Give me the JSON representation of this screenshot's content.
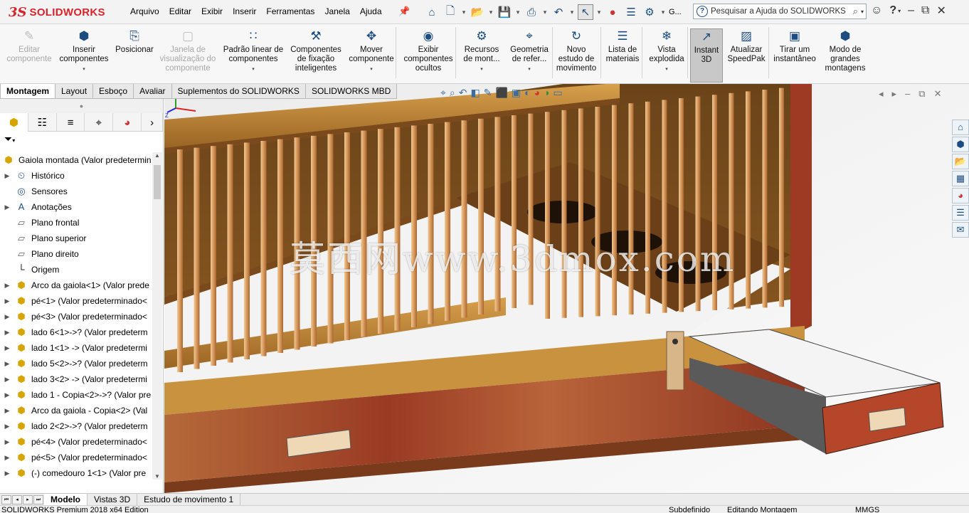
{
  "app": {
    "brand": "SOLIDWORKS",
    "brand_mark": "3S"
  },
  "menu": [
    "Arquivo",
    "Editar",
    "Exibir",
    "Inserir",
    "Ferramentas",
    "Janela",
    "Ajuda"
  ],
  "quick_access": {
    "more_label": "G..."
  },
  "search": {
    "placeholder": "Pesquisar a Ajuda do SOLIDWORKS"
  },
  "commands": [
    {
      "label1": "Editar",
      "label2": "componente",
      "label3": "",
      "disabled": true,
      "dropdown": false,
      "active": false,
      "icon": "edit-component-icon"
    },
    {
      "label1": "Inserir",
      "label2": "componentes",
      "label3": "",
      "disabled": false,
      "dropdown": true,
      "active": false,
      "icon": "insert-components-icon"
    },
    {
      "label1": "Posicionar",
      "label2": "",
      "label3": "",
      "disabled": false,
      "dropdown": false,
      "active": false,
      "icon": "mate-icon"
    },
    {
      "label1": "Janela de",
      "label2": "visualização do",
      "label3": "componente",
      "disabled": true,
      "dropdown": false,
      "active": false,
      "icon": "component-preview-icon"
    },
    {
      "label1": "Padrão linear de",
      "label2": "componentes",
      "label3": "",
      "disabled": false,
      "dropdown": true,
      "active": false,
      "icon": "linear-pattern-icon"
    },
    {
      "label1": "Componentes",
      "label2": "de fixação",
      "label3": "inteligentes",
      "disabled": false,
      "dropdown": false,
      "active": false,
      "icon": "smart-fasteners-icon"
    },
    {
      "label1": "Mover",
      "label2": "componente",
      "label3": "",
      "disabled": false,
      "dropdown": true,
      "active": false,
      "icon": "move-component-icon"
    },
    {
      "label1": "Exibir",
      "label2": "componentes",
      "label3": "ocultos",
      "disabled": false,
      "dropdown": false,
      "active": false,
      "icon": "show-hidden-icon"
    },
    {
      "label1": "Recursos",
      "label2": "de mont...",
      "label3": "",
      "disabled": false,
      "dropdown": true,
      "active": false,
      "icon": "assembly-features-icon"
    },
    {
      "label1": "Geometria",
      "label2": "de refer...",
      "label3": "",
      "disabled": false,
      "dropdown": true,
      "active": false,
      "icon": "reference-geometry-icon"
    },
    {
      "label1": "Novo",
      "label2": "estudo de",
      "label3": "movimento",
      "disabled": false,
      "dropdown": false,
      "active": false,
      "icon": "motion-study-icon"
    },
    {
      "label1": "Lista de",
      "label2": "materiais",
      "label3": "",
      "disabled": false,
      "dropdown": false,
      "active": false,
      "icon": "bom-icon"
    },
    {
      "label1": "Vista",
      "label2": "explodida",
      "label3": "",
      "disabled": false,
      "dropdown": true,
      "active": false,
      "icon": "exploded-view-icon"
    },
    {
      "label1": "Instant",
      "label2": "3D",
      "label3": "",
      "disabled": false,
      "dropdown": false,
      "active": true,
      "icon": "instant3d-icon"
    },
    {
      "label1": "Atualizar",
      "label2": "SpeedPak",
      "label3": "",
      "disabled": false,
      "dropdown": false,
      "active": false,
      "icon": "speedpak-icon"
    },
    {
      "label1": "Tirar um",
      "label2": "instantâneo",
      "label3": "",
      "disabled": false,
      "dropdown": false,
      "active": false,
      "icon": "snapshot-icon"
    },
    {
      "label1": "Modo de",
      "label2": "grandes",
      "label3": "montagens",
      "disabled": false,
      "dropdown": false,
      "active": false,
      "icon": "large-assembly-icon"
    }
  ],
  "tabs": [
    {
      "label": "Montagem",
      "active": true
    },
    {
      "label": "Layout",
      "active": false
    },
    {
      "label": "Esboço",
      "active": false
    },
    {
      "label": "Avaliar",
      "active": false
    },
    {
      "label": "Suplementos do SOLIDWORKS",
      "active": false
    },
    {
      "label": "SOLIDWORKS MBD",
      "active": false
    }
  ],
  "tree": {
    "root": "Gaiola montada  (Valor predetermin",
    "items": [
      {
        "label": "Histórico",
        "icon": "history-icon",
        "expand": true,
        "kind": "folder"
      },
      {
        "label": "Sensores",
        "icon": "sensors-icon",
        "expand": false,
        "kind": "folder"
      },
      {
        "label": "Anotações",
        "icon": "annotations-icon",
        "expand": true,
        "kind": "folder"
      },
      {
        "label": "Plano frontal",
        "icon": "plane-icon",
        "expand": false,
        "kind": "plane"
      },
      {
        "label": "Plano superior",
        "icon": "plane-icon",
        "expand": false,
        "kind": "plane"
      },
      {
        "label": "Plano direito",
        "icon": "plane-icon",
        "expand": false,
        "kind": "plane"
      },
      {
        "label": "Origem",
        "icon": "origin-icon",
        "expand": false,
        "kind": "origin"
      },
      {
        "label": "Arco da gaiola<1> (Valor prede",
        "icon": "part-icon",
        "expand": true,
        "kind": "part"
      },
      {
        "label": "pé<1> (Valor predeterminado<",
        "icon": "part-icon",
        "expand": true,
        "kind": "part"
      },
      {
        "label": "pé<3> (Valor predeterminado<",
        "icon": "part-icon",
        "expand": true,
        "kind": "part"
      },
      {
        "label": "lado 6<1>->? (Valor predeterm",
        "icon": "part-icon",
        "expand": true,
        "kind": "part"
      },
      {
        "label": "lado 1<1> -> (Valor predetermi",
        "icon": "part-icon",
        "expand": true,
        "kind": "part"
      },
      {
        "label": "lado 5<2>->? (Valor predeterm",
        "icon": "part-icon",
        "expand": true,
        "kind": "part"
      },
      {
        "label": "lado 3<2> -> (Valor predetermi",
        "icon": "part-icon",
        "expand": true,
        "kind": "part"
      },
      {
        "label": "lado 1 - Copia<2>->? (Valor pre",
        "icon": "part-icon",
        "expand": true,
        "kind": "part"
      },
      {
        "label": "Arco da gaiola - Copia<2> (Val",
        "icon": "part-icon",
        "expand": true,
        "kind": "part"
      },
      {
        "label": "lado 2<2>->? (Valor predeterm",
        "icon": "part-icon",
        "expand": true,
        "kind": "part"
      },
      {
        "label": "pé<4> (Valor predeterminado<",
        "icon": "part-icon",
        "expand": true,
        "kind": "part"
      },
      {
        "label": "pé<5> (Valor predeterminado<",
        "icon": "part-icon",
        "expand": true,
        "kind": "part"
      },
      {
        "label": "(-) comedouro 1<1> (Valor pre",
        "icon": "part-icon",
        "expand": true,
        "kind": "part"
      }
    ]
  },
  "viewport": {
    "watermark": "莫西网www.3dmox.com"
  },
  "bottom_tabs": [
    {
      "label": "Modelo",
      "active": true
    },
    {
      "label": "Vistas 3D",
      "active": false
    },
    {
      "label": "Estudo de movimento 1",
      "active": false
    }
  ],
  "status": {
    "edition": "SOLIDWORKS Premium 2018 x64 Edition",
    "state": "Subdefinido",
    "mode": "Editando Montagem",
    "units": "MMGS"
  },
  "colors": {
    "brand": "#d8232a",
    "accent": "#1d4d80",
    "wood_light": "#c8923f",
    "wood_red": "#9e3a24"
  }
}
